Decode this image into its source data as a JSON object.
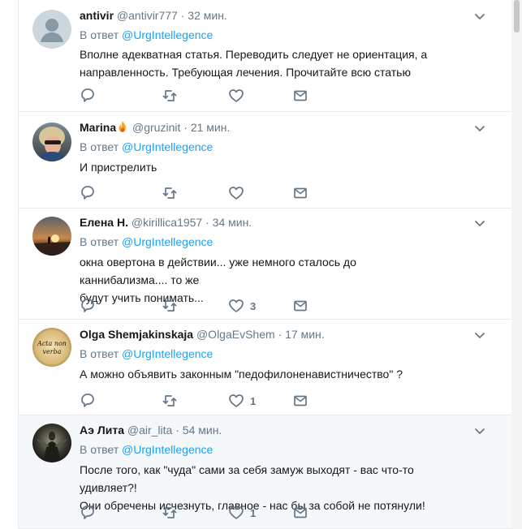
{
  "tweets": [
    {
      "name": "antivir",
      "handle": "@antivir777",
      "sep": "·",
      "time": "32 мин.",
      "reply_prefix": "В ответ",
      "reply_to": "@UrgIntellegence",
      "lines": [
        "Вполне адекватная статья. Переводить следует не ориентация, а",
        "направленность. Требующая лечения. Прочитайте всю статью"
      ],
      "likes": "",
      "avatar": "default-egg",
      "highlight": false
    },
    {
      "name": "Marina",
      "handle": "@gruzinit",
      "sep": "·",
      "time": "21 мин.",
      "reply_prefix": "В ответ",
      "reply_to": "@UrgIntellegence",
      "lines": [
        "И пристрелить"
      ],
      "likes": "",
      "avatar": "photo-woman",
      "name_icon": "fire-icon",
      "highlight": false
    },
    {
      "name": "Елена Н.",
      "handle": "@kirillica1957",
      "sep": "·",
      "time": "34 мин.",
      "reply_prefix": "В ответ",
      "reply_to": "@UrgIntellegence",
      "lines": [
        "окна овертона в действии... уже немного сталось до каннибализма....  то же",
        "будут учить понимать..."
      ],
      "likes": "3",
      "avatar": "photo-sunset",
      "highlight": false
    },
    {
      "name": "Olga Shemjakinskaja",
      "handle": "@OlgaEvShem",
      "sep": "·",
      "time": "17 мин.",
      "reply_prefix": "В ответ",
      "reply_to": "@UrgIntellegence",
      "lines": [
        "А можно объявить законным \"педофилоненавистничество\" ?"
      ],
      "likes": "1",
      "avatar": "parchment",
      "avatar_text": [
        "Acta non",
        "verba"
      ],
      "highlight": false
    },
    {
      "name": "Аэ Лита",
      "handle": "@air_lita",
      "sep": "·",
      "time": "54 мин.",
      "reply_prefix": "В ответ",
      "reply_to": "@UrgIntellegence",
      "lines": [
        "После того, как \"чуда\" сами за себя замуж выходят - вас что-то удивляет?!",
        "Они обречены исчезнуть, главное - нас бы за собой не потянули!"
      ],
      "likes": "1",
      "avatar": "photo-dark-figure",
      "highlight": true
    }
  ],
  "colors": {
    "link": "#1da1f2",
    "muted": "#657786",
    "text": "#14171a",
    "icon": "#657786"
  }
}
